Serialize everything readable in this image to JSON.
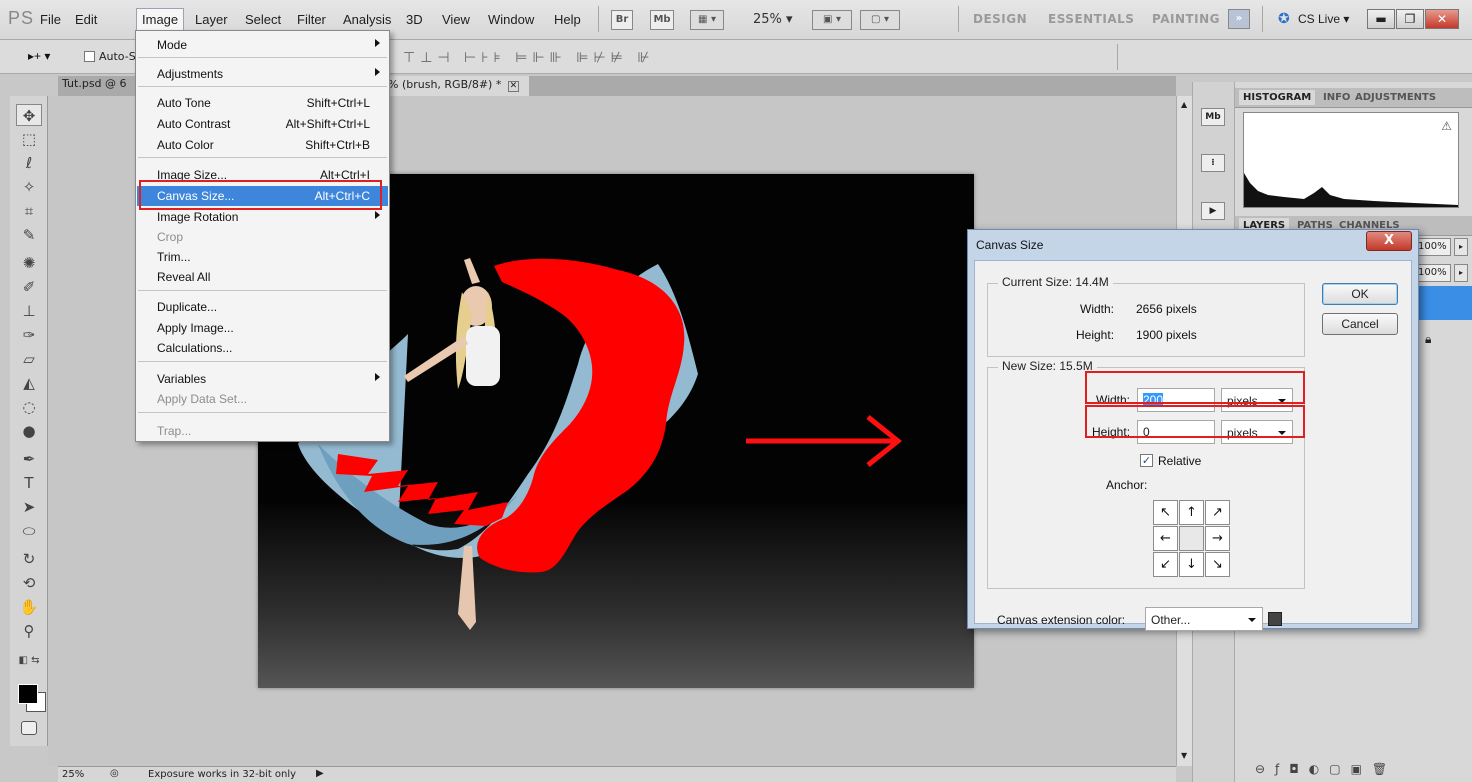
{
  "menubar": {
    "logo": "PS",
    "items": [
      "File",
      "Edit",
      "Image",
      "Layer",
      "Select",
      "Filter",
      "Analysis",
      "3D",
      "View",
      "Window",
      "Help"
    ],
    "bridge_label": "Br",
    "minibridge_label": "Mb",
    "zoom": "25% ▾",
    "workspaces": [
      "DESIGN",
      "ESSENTIALS",
      "PAINTING"
    ],
    "more": "»",
    "cslive": "CS Live ▾"
  },
  "options": {
    "tool_menu": "▸+ ▾",
    "auto_select": "Auto-Se"
  },
  "tabs": {
    "doc1": "Tut.psd @ 6",
    "doc2": "% (brush, RGB/8#) *"
  },
  "image_menu": {
    "items": [
      {
        "label": "Mode",
        "shortcut": "",
        "submenu": true,
        "disabled": false
      },
      {
        "label": "Adjustments",
        "shortcut": "",
        "submenu": true,
        "disabled": false
      },
      {
        "label": "Auto Tone",
        "shortcut": "Shift+Ctrl+L",
        "submenu": false,
        "disabled": false
      },
      {
        "label": "Auto Contrast",
        "shortcut": "Alt+Shift+Ctrl+L",
        "submenu": false,
        "disabled": false
      },
      {
        "label": "Auto Color",
        "shortcut": "Shift+Ctrl+B",
        "submenu": false,
        "disabled": false
      },
      {
        "label": "Image Size...",
        "shortcut": "Alt+Ctrl+I",
        "submenu": false,
        "disabled": false
      },
      {
        "label": "Canvas Size...",
        "shortcut": "Alt+Ctrl+C",
        "submenu": false,
        "disabled": false,
        "highlighted": true
      },
      {
        "label": "Image Rotation",
        "shortcut": "",
        "submenu": true,
        "disabled": false
      },
      {
        "label": "Crop",
        "shortcut": "",
        "submenu": false,
        "disabled": true
      },
      {
        "label": "Trim...",
        "shortcut": "",
        "submenu": false,
        "disabled": false
      },
      {
        "label": "Reveal All",
        "shortcut": "",
        "submenu": false,
        "disabled": false
      },
      {
        "label": "Duplicate...",
        "shortcut": "",
        "submenu": false,
        "disabled": false
      },
      {
        "label": "Apply Image...",
        "shortcut": "",
        "submenu": false,
        "disabled": false
      },
      {
        "label": "Calculations...",
        "shortcut": "",
        "submenu": false,
        "disabled": false
      },
      {
        "label": "Variables",
        "shortcut": "",
        "submenu": true,
        "disabled": false
      },
      {
        "label": "Apply Data Set...",
        "shortcut": "",
        "submenu": false,
        "disabled": true
      },
      {
        "label": "Trap...",
        "shortcut": "",
        "submenu": false,
        "disabled": true
      }
    ]
  },
  "dialog": {
    "title": "Canvas Size",
    "close": "X",
    "current_legend": "Current Size: 14.4M",
    "current_width_label": "Width:",
    "current_width_value": "2656 pixels",
    "current_height_label": "Height:",
    "current_height_value": "1900 pixels",
    "new_legend": "New Size: 15.5M",
    "width_label": "Width:",
    "width_value": "200",
    "width_unit": "pixels",
    "height_label": "Height:",
    "height_value": "0",
    "height_unit": "pixels",
    "relative_label": "Relative",
    "relative_checked": true,
    "anchor_label": "Anchor:",
    "anchor_arrows": [
      "↖",
      "↑",
      "↗",
      "←",
      "",
      "→",
      "↙",
      "↓",
      "↘"
    ],
    "ext_color_label": "Canvas extension color:",
    "ext_color_value": "Other...",
    "ok": "OK",
    "cancel": "Cancel"
  },
  "panels": {
    "top_tabs": [
      "HISTOGRAM",
      "INFO",
      "ADJUSTMENTS"
    ],
    "layer_tabs": [
      "LAYERS",
      "PATHS",
      "CHANNELS"
    ],
    "opacity": "100%",
    "fill": "100%"
  },
  "status": {
    "zoom": "25%",
    "message": "Exposure works in 32-bit only"
  }
}
